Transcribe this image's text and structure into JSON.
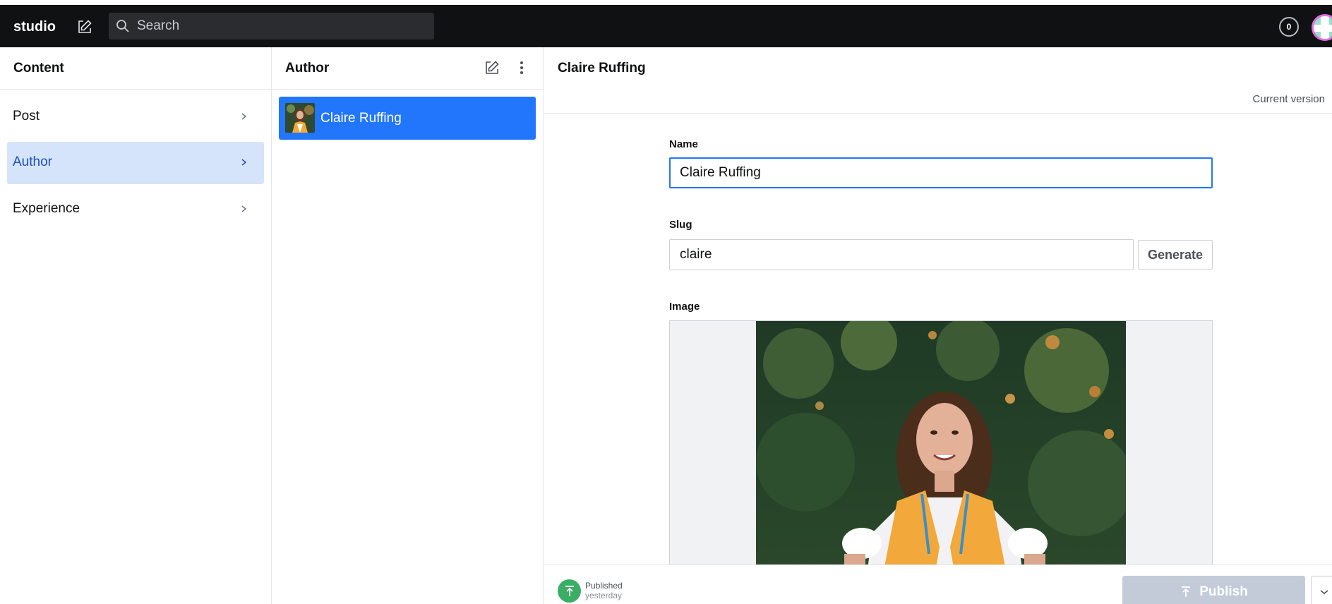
{
  "app": {
    "brand": "studio",
    "search_placeholder": "Search",
    "notification_count": "0"
  },
  "content_pane": {
    "title": "Content",
    "items": [
      {
        "label": "Post",
        "active": false
      },
      {
        "label": "Author",
        "active": true
      },
      {
        "label": "Experience",
        "active": false
      }
    ]
  },
  "author_pane": {
    "title": "Author",
    "documents": [
      {
        "title": "Claire Ruffing",
        "selected": true
      }
    ]
  },
  "document": {
    "title": "Claire Ruffing",
    "version_label": "Current version",
    "fields": {
      "name_label": "Name",
      "name_value": "Claire Ruffing",
      "slug_label": "Slug",
      "slug_value": "claire",
      "generate_label": "Generate",
      "image_label": "Image"
    },
    "footer": {
      "status": "Published",
      "status_time": "yesterday",
      "publish_label": "Publish"
    }
  },
  "colors": {
    "navbar": "#101112",
    "accent": "#2276fc",
    "active_menu_bg": "#d6e4fb",
    "published_green": "#3aae64",
    "publish_disabled": "#c3cbd8"
  }
}
